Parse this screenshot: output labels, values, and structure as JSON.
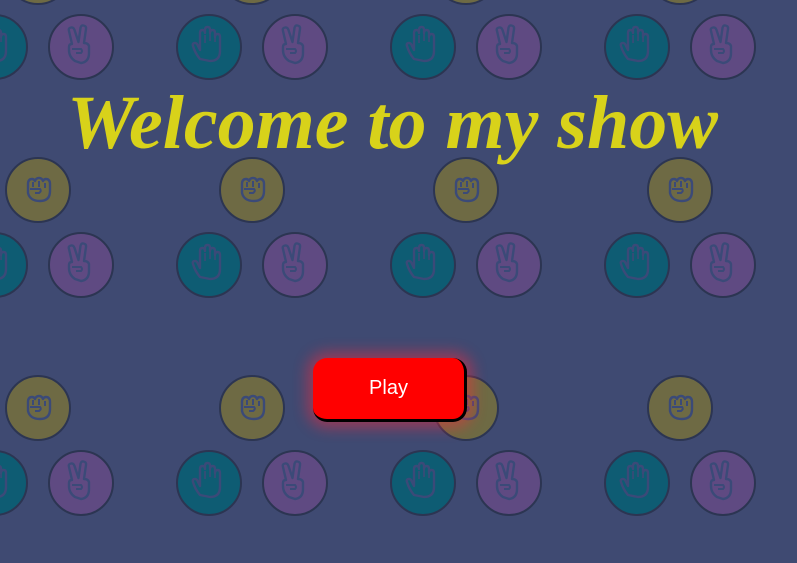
{
  "title": "Welcome to my show",
  "play_label": "Play",
  "colors": {
    "background": "#3f4a72",
    "title": "#d8d21a",
    "play_button": "#ff0000",
    "rock_token": "#6e6a44",
    "paper_token": "#0e5c73",
    "scissors_token": "#5f4a82",
    "token_icon": "#3b4a78"
  },
  "background_tokens": {
    "rock": "fist-icon",
    "paper": "hand-icon",
    "scissors": "victory-hand-icon"
  }
}
